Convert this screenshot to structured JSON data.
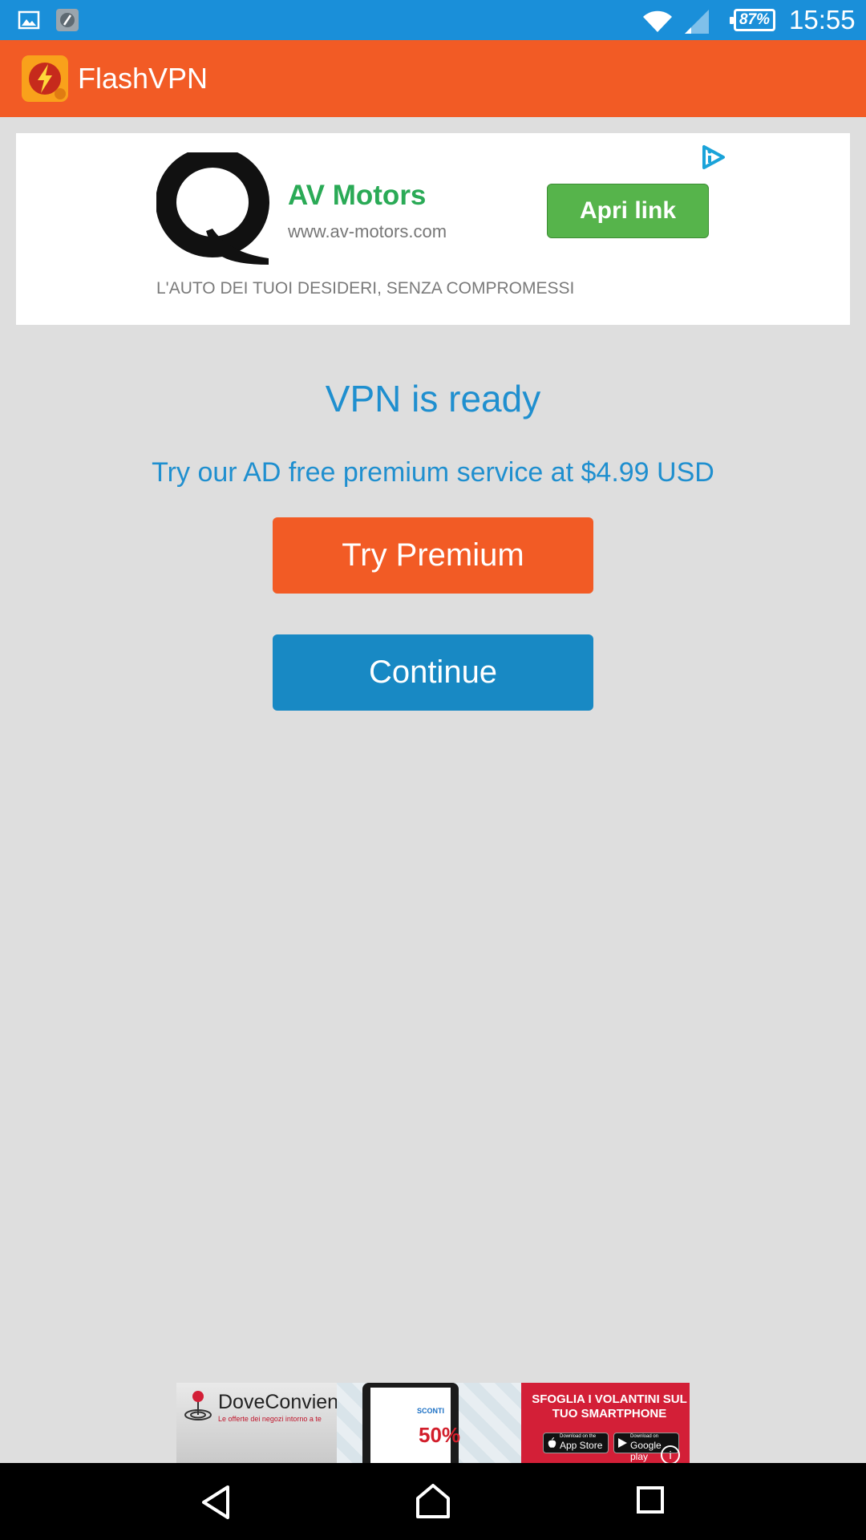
{
  "status_bar": {
    "icons": [
      "image-notification-icon",
      "app-notification-icon",
      "wifi-icon",
      "signal-icon"
    ],
    "battery": "87%",
    "time": "15:55"
  },
  "app_bar": {
    "title": "FlashVPN",
    "logo_icon": "flashvpn-logo-icon",
    "color": "#f25b25"
  },
  "ad": {
    "title": "AV Motors",
    "url": "www.av-motors.com",
    "button_label": "Apri link",
    "tagline": "L'AUTO DEI TUOI DESIDERI, SENZA COMPROMESSI",
    "choices_icon": "adchoices-icon",
    "button_color": "#56b44b"
  },
  "main": {
    "status_text": "VPN is ready",
    "premium_text": "Try our AD free premium service at $4.99 USD",
    "try_premium_label": "Try Premium",
    "continue_label": "Continue",
    "accent": "#1f8fcf",
    "premium_color": "#f25b25",
    "continue_color": "#1889c4"
  },
  "banner": {
    "brand": "DoveConviene",
    "subtitle": "Le offerte dei negozi intorno a te",
    "headline": "SFOGLIA I VOLANTINI SUL TUO SMARTPHONE",
    "sconti": "SCONTI",
    "percent": "50%",
    "appstore_small": "Download on the",
    "appstore_big": "App Store",
    "google_small": "Download on",
    "google_big": "Google play",
    "info": "i"
  },
  "nav_bar": {
    "icons": [
      "back-icon",
      "home-icon",
      "recent-apps-icon"
    ]
  }
}
